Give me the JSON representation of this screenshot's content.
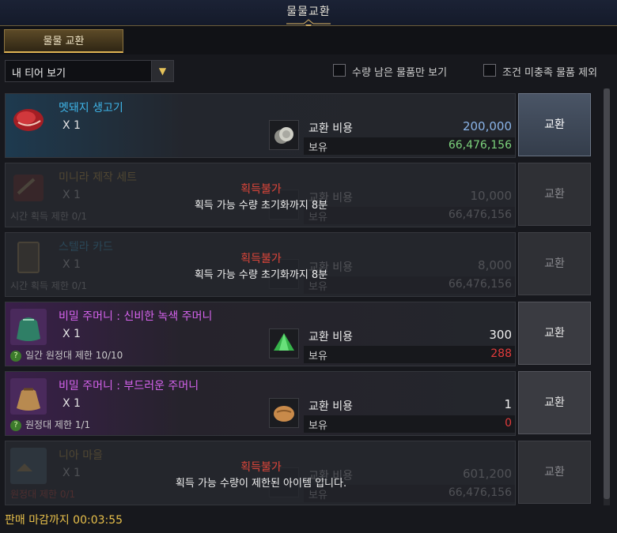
{
  "window": {
    "title": "물물교환"
  },
  "tabs": [
    {
      "label": "물물 교환",
      "active": true
    }
  ],
  "filter": {
    "dropdown_value": "내 티어 보기",
    "check_remaining": "수량 남은 물품만 보기",
    "check_exclude": "조건 미충족 물품 제외"
  },
  "common": {
    "exchange_label": "교환",
    "cost_label": "교환 비용",
    "own_label": "보유"
  },
  "rows": [
    {
      "name": "멧돼지 생고기",
      "qty": "X 1",
      "cost": "200,000",
      "owned": "66,476,156",
      "name_color": "#3fb6ea",
      "owned_color": "#7cd27c",
      "icon": "raw-meat-icon",
      "cost_icon": "silver-coin-icon",
      "status": "available"
    },
    {
      "name": "미니라 제작 세트",
      "qty": "X 1",
      "limit": "시간 획득 제한 0/1",
      "cost": "10,000",
      "owned": "66,476,156",
      "name_color": "#e9b94a",
      "icon": "crafting-set-icon",
      "cost_icon": "silver-coin-icon",
      "status": "unavailable",
      "unavailable_title": "획득불가",
      "unavailable_reason": "획득 가능 수량 초기화까지 8분"
    },
    {
      "name": "스텔라 카드",
      "qty": "X 1",
      "limit": "시간 획득 제한 0/1",
      "cost": "8,000",
      "owned": "66,476,156",
      "name_color": "#3fb6ea",
      "icon": "card-icon",
      "cost_icon": "silver-coin-icon",
      "status": "unavailable",
      "unavailable_title": "획득불가",
      "unavailable_reason": "획득 가능 수량 초기화까지 8분"
    },
    {
      "name": "비밀 주머니 : 신비한 녹색 주머니",
      "qty": "X 1",
      "limit": "일간 원정대 제한 10/10",
      "cost": "300",
      "owned": "288",
      "name_color": "#d663ee",
      "owned_color": "#e23b3b",
      "icon": "green-pouch-icon",
      "cost_icon": "green-crystal-icon",
      "status": "available"
    },
    {
      "name": "비밀 주머니 : 부드러운 주머니",
      "qty": "X 1",
      "limit": "원정대 제한 1/1",
      "cost": "1",
      "owned": "0",
      "name_color": "#d663ee",
      "owned_color": "#e23b3b",
      "icon": "sack-icon",
      "cost_icon": "bread-icon",
      "status": "available"
    },
    {
      "name": "니아 마을",
      "qty": "X 1",
      "limit": "원정대 제한 0/1",
      "cost": "601,200",
      "owned": "66,476,156",
      "name_color": "#e9b94a",
      "icon": "village-icon",
      "cost_icon": "silver-coin-icon",
      "status": "unavailable",
      "unavailable_title": "획득불가",
      "unavailable_reason": "획득 가능 수량이 제한된 아이템 입니다."
    }
  ],
  "footer": {
    "deadline": "판매 마감까지 00:03:55"
  },
  "colors": {
    "accent_gold": "#e8c04a",
    "unavailable_red": "#e0463a",
    "cost_value_blue": "#8ab4e8"
  }
}
